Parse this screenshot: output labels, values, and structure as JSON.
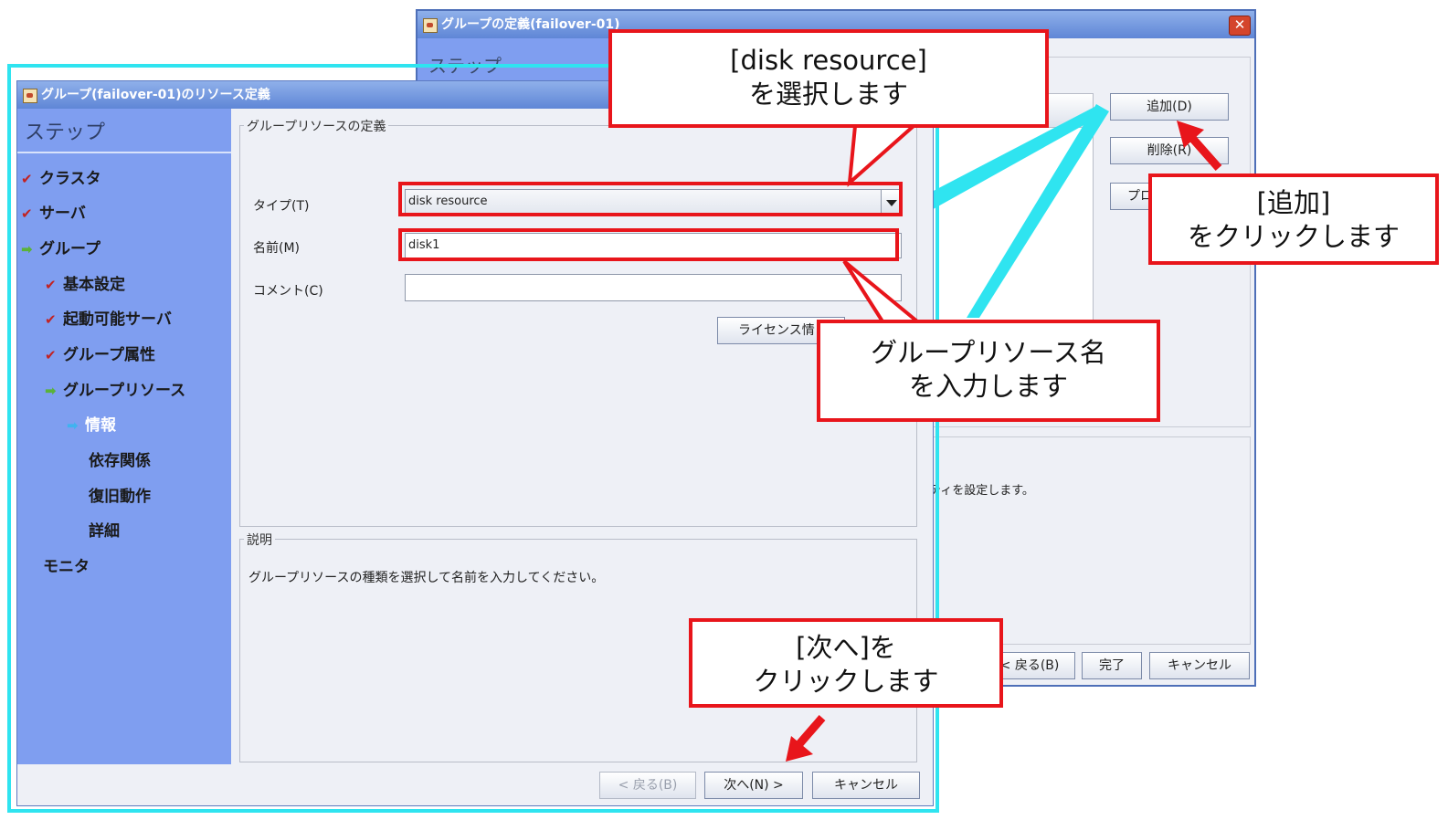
{
  "back_window": {
    "title": "グループの定義(failover-01)",
    "step_heading": "ステップ",
    "buttons": {
      "add": "追加(D)",
      "remove": "削除(R)",
      "properties": "プロ",
      "back": "< 戻る(B)",
      "finish": "完了",
      "cancel": "キャンセル"
    },
    "description_text": "ティを設定します。"
  },
  "front_window": {
    "title": "グループ(failover-01)のリソース定義",
    "steps_heading": "ステップ",
    "steps": [
      {
        "label": "クラスタ",
        "status": "done"
      },
      {
        "label": "サーバ",
        "status": "done"
      },
      {
        "label": "グループ",
        "status": "active"
      },
      {
        "label": "基本設定",
        "status": "done"
      },
      {
        "label": "起動可能サーバ",
        "status": "done"
      },
      {
        "label": "グループ属性",
        "status": "done"
      },
      {
        "label": "グループリソース",
        "status": "active"
      },
      {
        "label": "情報",
        "status": "current"
      },
      {
        "label": "依存関係",
        "status": "pending"
      },
      {
        "label": "復旧動作",
        "status": "pending"
      },
      {
        "label": "詳細",
        "status": "pending"
      },
      {
        "label": "モニタ",
        "status": "pending"
      }
    ],
    "definition_legend": "グループリソースの定義",
    "type_label": "タイプ(T)",
    "type_value": "disk resource",
    "name_label": "名前(M)",
    "name_value": "disk1",
    "comment_label": "コメント(C)",
    "comment_value": "",
    "license_button": "ライセンス情",
    "description_legend": "説明",
    "description_text": "グループリソースの種類を選択して名前を入力してください。",
    "buttons": {
      "back": "< 戻る(B)",
      "next": "次へ(N) >",
      "cancel": "キャンセル"
    }
  },
  "callouts": {
    "select_resource": [
      "[disk resource]",
      "を選択します"
    ],
    "click_add": [
      "[追加]",
      "をクリックします"
    ],
    "enter_name": [
      "グループリソース名",
      "を入力します"
    ],
    "click_next": [
      "[次へ]を",
      "クリックします"
    ]
  },
  "colors": {
    "highlight_red": "#e8151b",
    "outline_cyan": "#2fe4f0",
    "steps_panel": "#7f9ef0",
    "titlebar": "#6a8fda"
  }
}
